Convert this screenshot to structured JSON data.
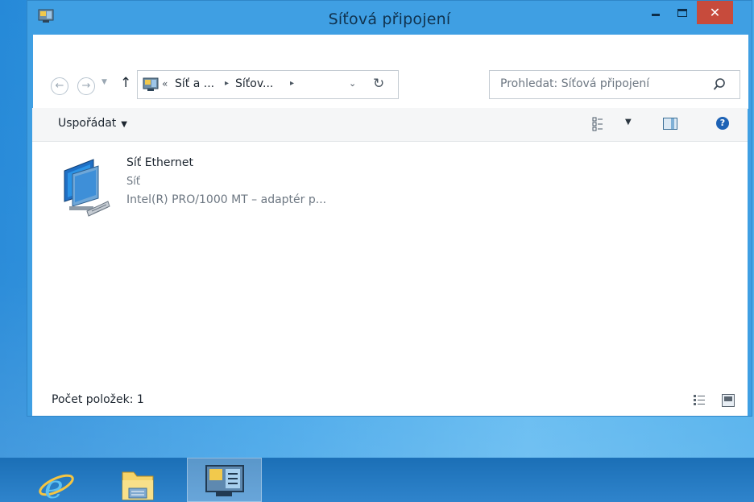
{
  "window": {
    "title": "Síťová připojení",
    "close_glyph": "✕"
  },
  "navigation": {
    "back_glyph": "←",
    "forward_glyph": "→",
    "recent_glyph": "▼",
    "up_glyph": "↑",
    "address": {
      "overflow_glyph": "«",
      "breadcrumbs": [
        "Síť a ...",
        "Síťov..."
      ],
      "separator_glyph": "▸",
      "dropdown_glyph": "⌄",
      "refresh_glyph": "↻"
    },
    "search": {
      "placeholder": "Prohledat: Síťová připojení"
    }
  },
  "toolbar": {
    "organize_label": "Uspořádat",
    "caret_glyph": "▼",
    "help_glyph": "?"
  },
  "items": [
    {
      "name": "Síť Ethernet",
      "type": "Síť",
      "adapter": "Intel(R) PRO/1000 MT – adaptér p..."
    }
  ],
  "statusbar": {
    "item_count": "Počet položek: 1"
  },
  "taskbar": {
    "apps": [
      "internet-explorer",
      "file-explorer",
      "network-connections"
    ]
  },
  "icons": {
    "app": "network-connections-icon",
    "item": "ethernet-network-icon",
    "search": "search-icon",
    "view": "change-view-icon",
    "preview_pane": "preview-pane-icon",
    "help": "help-icon"
  },
  "colors": {
    "close_button": "#c74b3c",
    "window_frame": "#3f9fe3",
    "taskbar": "#1b6fb6"
  }
}
